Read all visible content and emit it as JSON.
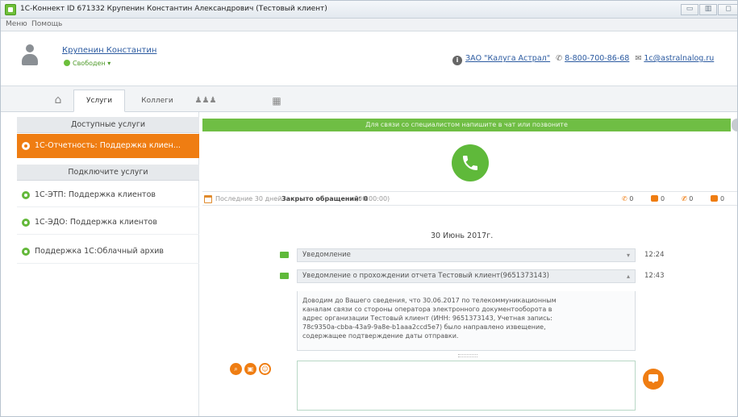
{
  "window": {
    "title": "1С-Коннект ID 671332 Крупенин Константин Александрович (Тестовый клиент)"
  },
  "menu": [
    "Меню",
    "Помощь"
  ],
  "user": {
    "name": "Крупенин Константин",
    "status": "Свободен ▾"
  },
  "contact": {
    "org": "ЗАО \"Калуга Астрал\"",
    "phone": "8-800-700-86-68",
    "email": "1c@astralnalog.ru"
  },
  "tabs": [
    {
      "label": "Услуги"
    },
    {
      "label": "Коллеги"
    }
  ],
  "sidebar": {
    "available_header": "Доступные услуги",
    "active_service": "1С-Отчетность: Поддержка клиен...",
    "connect_header": "Подключите услуги",
    "services": [
      "1С-ЭТП: Поддержка клиентов",
      "1С-ЭДО: Поддержка клиентов",
      "Поддержка 1С:Облачный архив"
    ]
  },
  "chat": {
    "notice": "Для связи со специалистом напишите в чат или позвоните",
    "stats": {
      "period": "Последние 30 дней",
      "closed": "Закрыто обращений: 0",
      "duration": "(00:00:00)",
      "calls": "0",
      "messages": "0",
      "missed": "0",
      "files": "0"
    },
    "date": "30 Июнь 2017г.",
    "messages": [
      {
        "title": "Уведомление",
        "time": "12:24"
      },
      {
        "title": "Уведомление о прохождении отчета Тестовый клиент(9651373143)",
        "time": "12:43"
      }
    ],
    "message_body": [
      "Доводим до Вашего сведения, что 30.06.2017 по телекоммуникационным",
      "каналам связи со стороны оператора электронного документооборота в",
      "адрес организации Тестовый клиент (ИНН: 9651373143, Учетная запись:",
      "78c9350a-cbba-43a9-9a8e-b1aaa2ccd5e7) было направлено извещение,",
      "содержащее подтверждение даты отправки."
    ]
  },
  "colors": {
    "accent": "#ef7d12",
    "green": "#5fb93a"
  }
}
